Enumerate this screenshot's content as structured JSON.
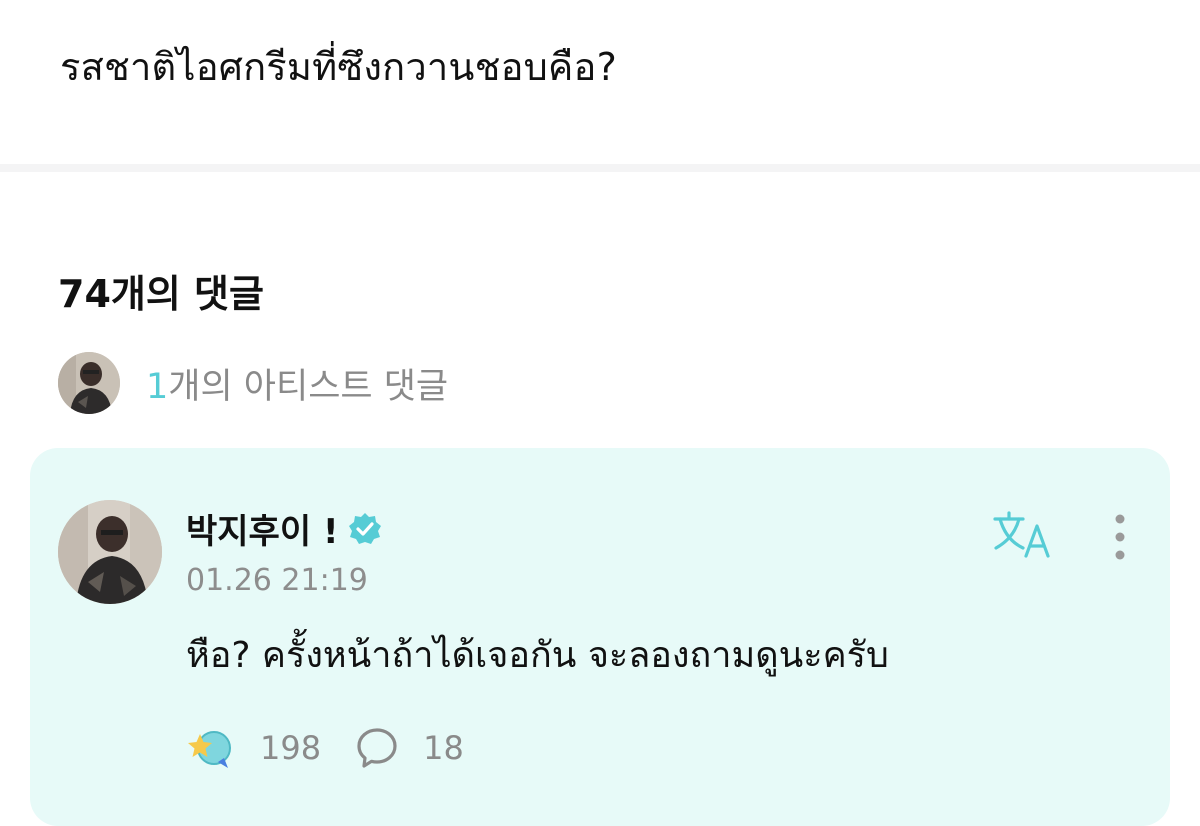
{
  "post": {
    "question": "รสชาติไอศกรีมที่ซึงกวานชอบคือ?"
  },
  "comments_header": {
    "title": "74개의 댓글"
  },
  "artist_comments": {
    "count": "1",
    "label": "개의 아티스트 댓글"
  },
  "comment": {
    "author": "박지후이 !",
    "timestamp": "01.26 21:19",
    "text": "หือ? ครั้งหน้าถ้าได้เจอกัน จะลองถามดูนะครับ",
    "likes": "198",
    "replies": "18",
    "icons": {
      "verified": "verified-badge-icon",
      "translate": "translate-icon",
      "more": "more-vertical-icon",
      "like": "star-reaction-icon",
      "reply": "speech-bubble-icon"
    }
  },
  "colors": {
    "accent": "#56ccd5",
    "card_background": "#e7faf8",
    "muted_text": "#8a8a8a"
  }
}
